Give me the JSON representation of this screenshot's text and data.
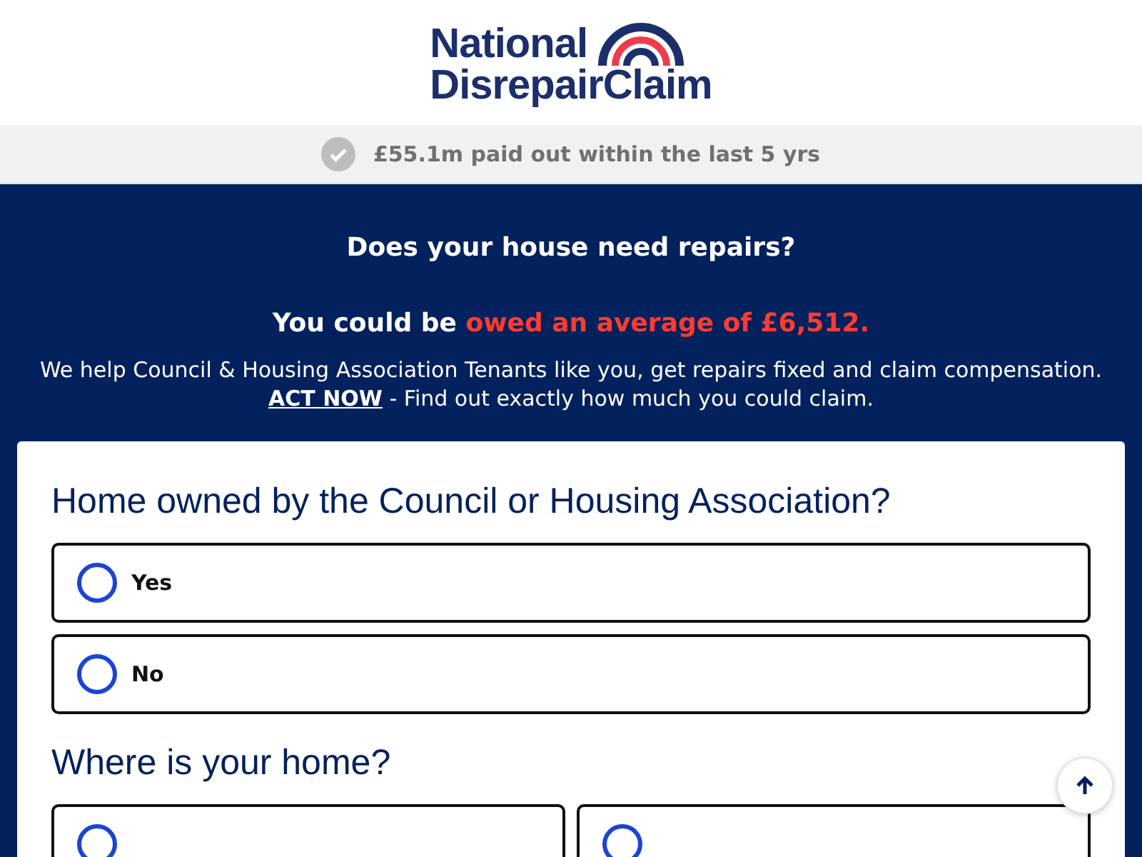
{
  "logo": {
    "line1": "National",
    "line2": "DisrepairClaim"
  },
  "trust_bar": {
    "text": "£55.1m paid out within the last 5 yrs"
  },
  "hero": {
    "heading": "Does your house need repairs?",
    "lead": "You could be",
    "highlight": "owed an average of £6,512.",
    "intro_before": "We help Council & Housing Association Tenants like you, get repairs fixed and claim compensation.",
    "intro_link": "ACT NOW",
    "intro_after": "- Find out exactly how much you could claim."
  },
  "questions": [
    {
      "title": "Home owned by the Council or Housing Association?",
      "kind": "stacked",
      "options": [
        {
          "label": "Yes",
          "selected": false
        },
        {
          "label": "No",
          "selected": false
        }
      ]
    },
    {
      "title": "Where is your home?",
      "kind": "columns",
      "options": [
        {
          "selected": false
        },
        {
          "selected": false
        }
      ]
    }
  ]
}
